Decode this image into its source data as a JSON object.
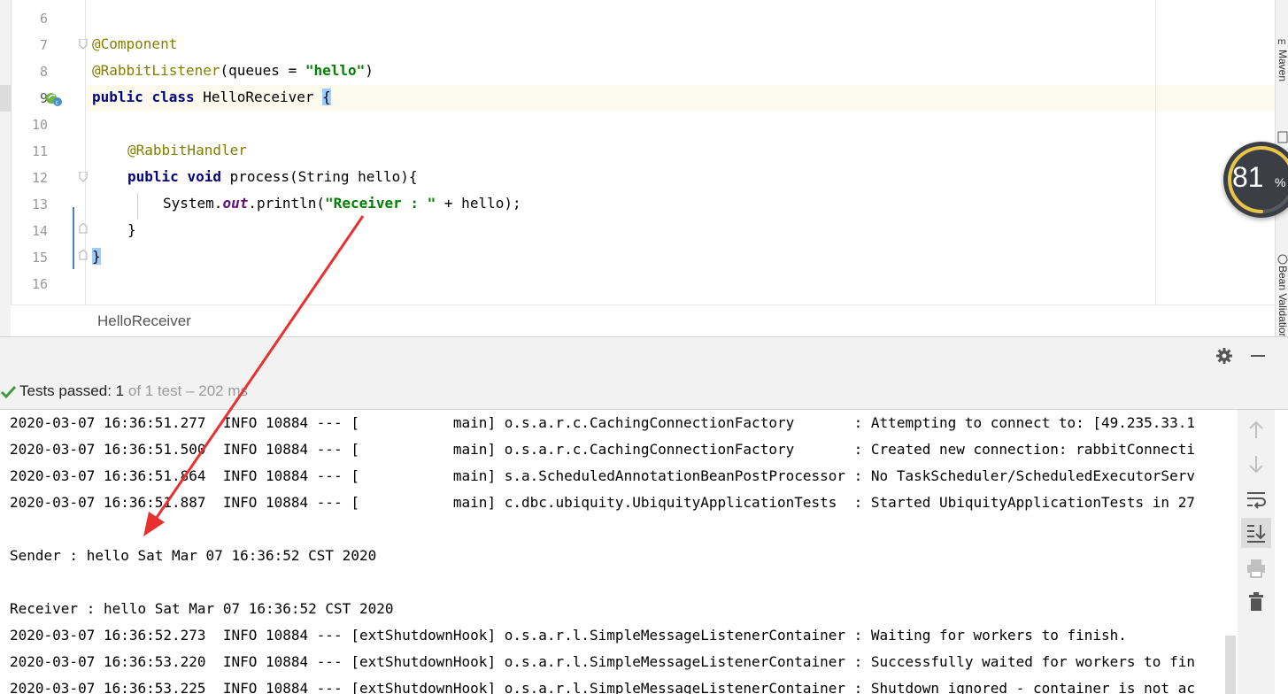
{
  "editor": {
    "lines": [
      {
        "num": "6"
      },
      {
        "num": "7",
        "annotation": "@Component"
      },
      {
        "num": "8",
        "annotation": "@RabbitListener",
        "rest": "(queues = ",
        "str": "\"hello\"",
        "end": ")"
      },
      {
        "num": "9",
        "kw1": "public",
        "kw2": "class",
        "name": "HelloReceiver",
        "brace": "{"
      },
      {
        "num": "10"
      },
      {
        "num": "11",
        "annotation": "@RabbitHandler"
      },
      {
        "num": "12",
        "kw1": "public",
        "kw2": "void",
        "rest": "process(String hello){"
      },
      {
        "num": "13",
        "pre": "System.",
        "field": "out",
        "mid": ".println(",
        "str": "\"Receiver : \"",
        "end": " + hello);"
      },
      {
        "num": "14",
        "text": "}"
      },
      {
        "num": "15",
        "text": "}"
      },
      {
        "num": "16"
      }
    ],
    "breadcrumb": "HelloReceiver"
  },
  "gauge": {
    "value": "81",
    "unit": "%",
    "arc_color": "#e8c547"
  },
  "right_strip": {
    "tab1": "Maven",
    "tab2": "Bean Validation"
  },
  "tests": {
    "prefix": "Tests passed: ",
    "passed": "1",
    "suffix": " of 1 test – 202 ms"
  },
  "console": {
    "lines": [
      "2020-03-07 16:36:51.277  INFO 10884 --- [           main] o.s.a.r.c.CachingConnectionFactory       : Attempting to connect to: [49.235.33.1",
      "2020-03-07 16:36:51.500  INFO 10884 --- [           main] o.s.a.r.c.CachingConnectionFactory       : Created new connection: rabbitConnecti",
      "2020-03-07 16:36:51.864  INFO 10884 --- [           main] s.a.ScheduledAnnotationBeanPostProcessor : No TaskScheduler/ScheduledExecutorServ",
      "2020-03-07 16:36:51.887  INFO 10884 --- [           main] c.dbc.ubiquity.UbiquityApplicationTests  : Started UbiquityApplicationTests in 27",
      "",
      "Sender : hello Sat Mar 07 16:36:52 CST 2020",
      "",
      "Receiver : hello Sat Mar 07 16:36:52 CST 2020",
      "2020-03-07 16:36:52.273  INFO 10884 --- [extShutdownHook] o.s.a.r.l.SimpleMessageListenerContainer : Waiting for workers to finish.",
      "2020-03-07 16:36:53.220  INFO 10884 --- [extShutdownHook] o.s.a.r.l.SimpleMessageListenerContainer : Successfully waited for workers to fin",
      "2020-03-07 16:36:53.225  INFO 10884 --- [extShutdownHook] o.s.a.r.l.SimpleMessageListenerContainer : Shutdown ignored - container is not ac"
    ]
  },
  "colors": {
    "annotation": "#808000",
    "keyword": "#000080",
    "string": "#008000",
    "arrow": "#e8312f",
    "pass": "#3c9a3c"
  }
}
